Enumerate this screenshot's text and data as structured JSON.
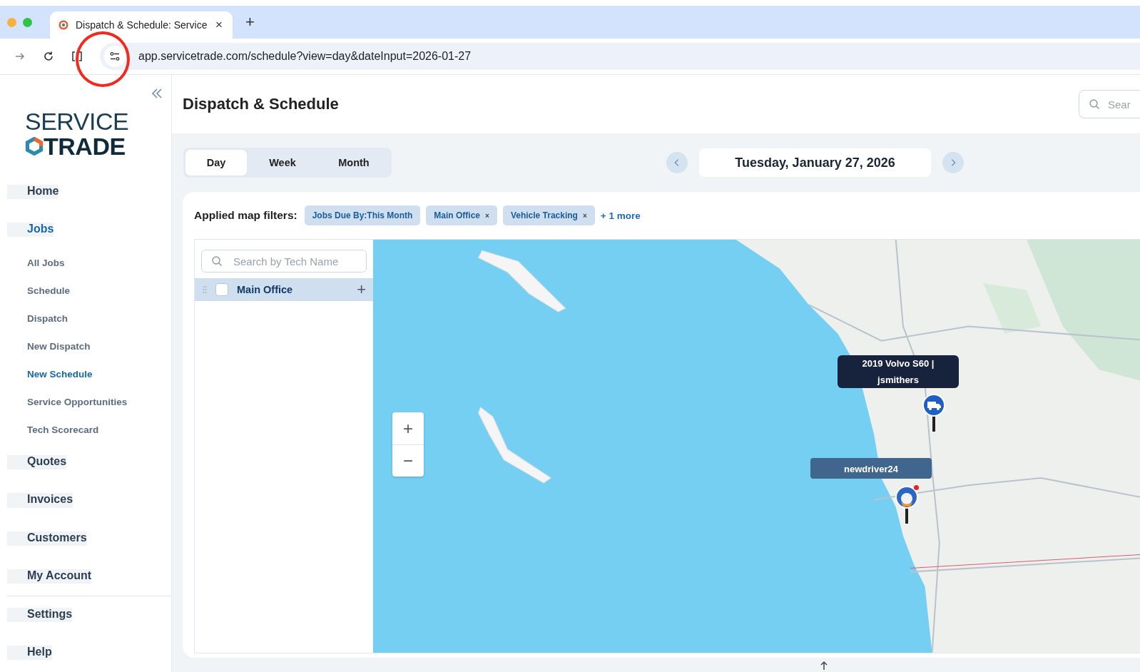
{
  "browser": {
    "tab_title": "Dispatch & Schedule: Service",
    "tab_close": "×",
    "new_tab": "+",
    "url": "app.servicetrade.com/schedule?view=day&dateInput=2026-01-27"
  },
  "sidebar": {
    "logo": {
      "line1": "SERVICE",
      "line2": "TRADE"
    },
    "items": [
      {
        "label": "Home",
        "kind": "main",
        "selected": false
      },
      {
        "label": "Jobs",
        "kind": "main",
        "selected": true
      },
      {
        "label": "All Jobs",
        "kind": "sub",
        "selected": false
      },
      {
        "label": "Schedule",
        "kind": "sub",
        "selected": false
      },
      {
        "label": "Dispatch",
        "kind": "sub",
        "selected": false
      },
      {
        "label": "New Dispatch",
        "kind": "sub",
        "selected": false
      },
      {
        "label": "New Schedule",
        "kind": "sub",
        "selected": true
      },
      {
        "label": "Service Opportunities",
        "kind": "sub",
        "selected": false
      },
      {
        "label": "Tech Scorecard",
        "kind": "sub",
        "selected": false
      },
      {
        "label": "Quotes",
        "kind": "main",
        "selected": false
      },
      {
        "label": "Invoices",
        "kind": "main",
        "selected": false
      },
      {
        "label": "Customers",
        "kind": "main",
        "selected": false
      },
      {
        "label": "My Account",
        "kind": "main",
        "selected": false
      }
    ],
    "bottom_items": [
      {
        "label": "Settings",
        "selected": false
      },
      {
        "label": "Help",
        "selected": false
      }
    ]
  },
  "header": {
    "title": "Dispatch & Schedule",
    "search_placeholder": "Sear"
  },
  "view_tabs": [
    {
      "label": "Day",
      "selected": true
    },
    {
      "label": "Week",
      "selected": false
    },
    {
      "label": "Month",
      "selected": false
    }
  ],
  "date": "Tuesday, January 27, 2026",
  "filters": {
    "label": "Applied map filters:",
    "remove_symbol": "×",
    "chips": [
      {
        "label": "Jobs Due By:This Month",
        "removable": false
      },
      {
        "label": "Main Office",
        "removable": true
      },
      {
        "label": "Vehicle Tracking",
        "removable": true
      }
    ],
    "more": "+ 1 more"
  },
  "tech_panel": {
    "search_placeholder": "Search by Tech Name",
    "groups": [
      {
        "name": "Main Office",
        "checked": false,
        "add": "+"
      }
    ]
  },
  "map": {
    "zoom_in": "+",
    "zoom_out": "−",
    "markers": [
      {
        "kind": "truck",
        "labels": [
          "2019 Volvo S60 |",
          "jsmithers"
        ],
        "alert": false
      },
      {
        "kind": "avatar",
        "labels": [
          "newdriver24"
        ],
        "alert": true
      }
    ]
  }
}
